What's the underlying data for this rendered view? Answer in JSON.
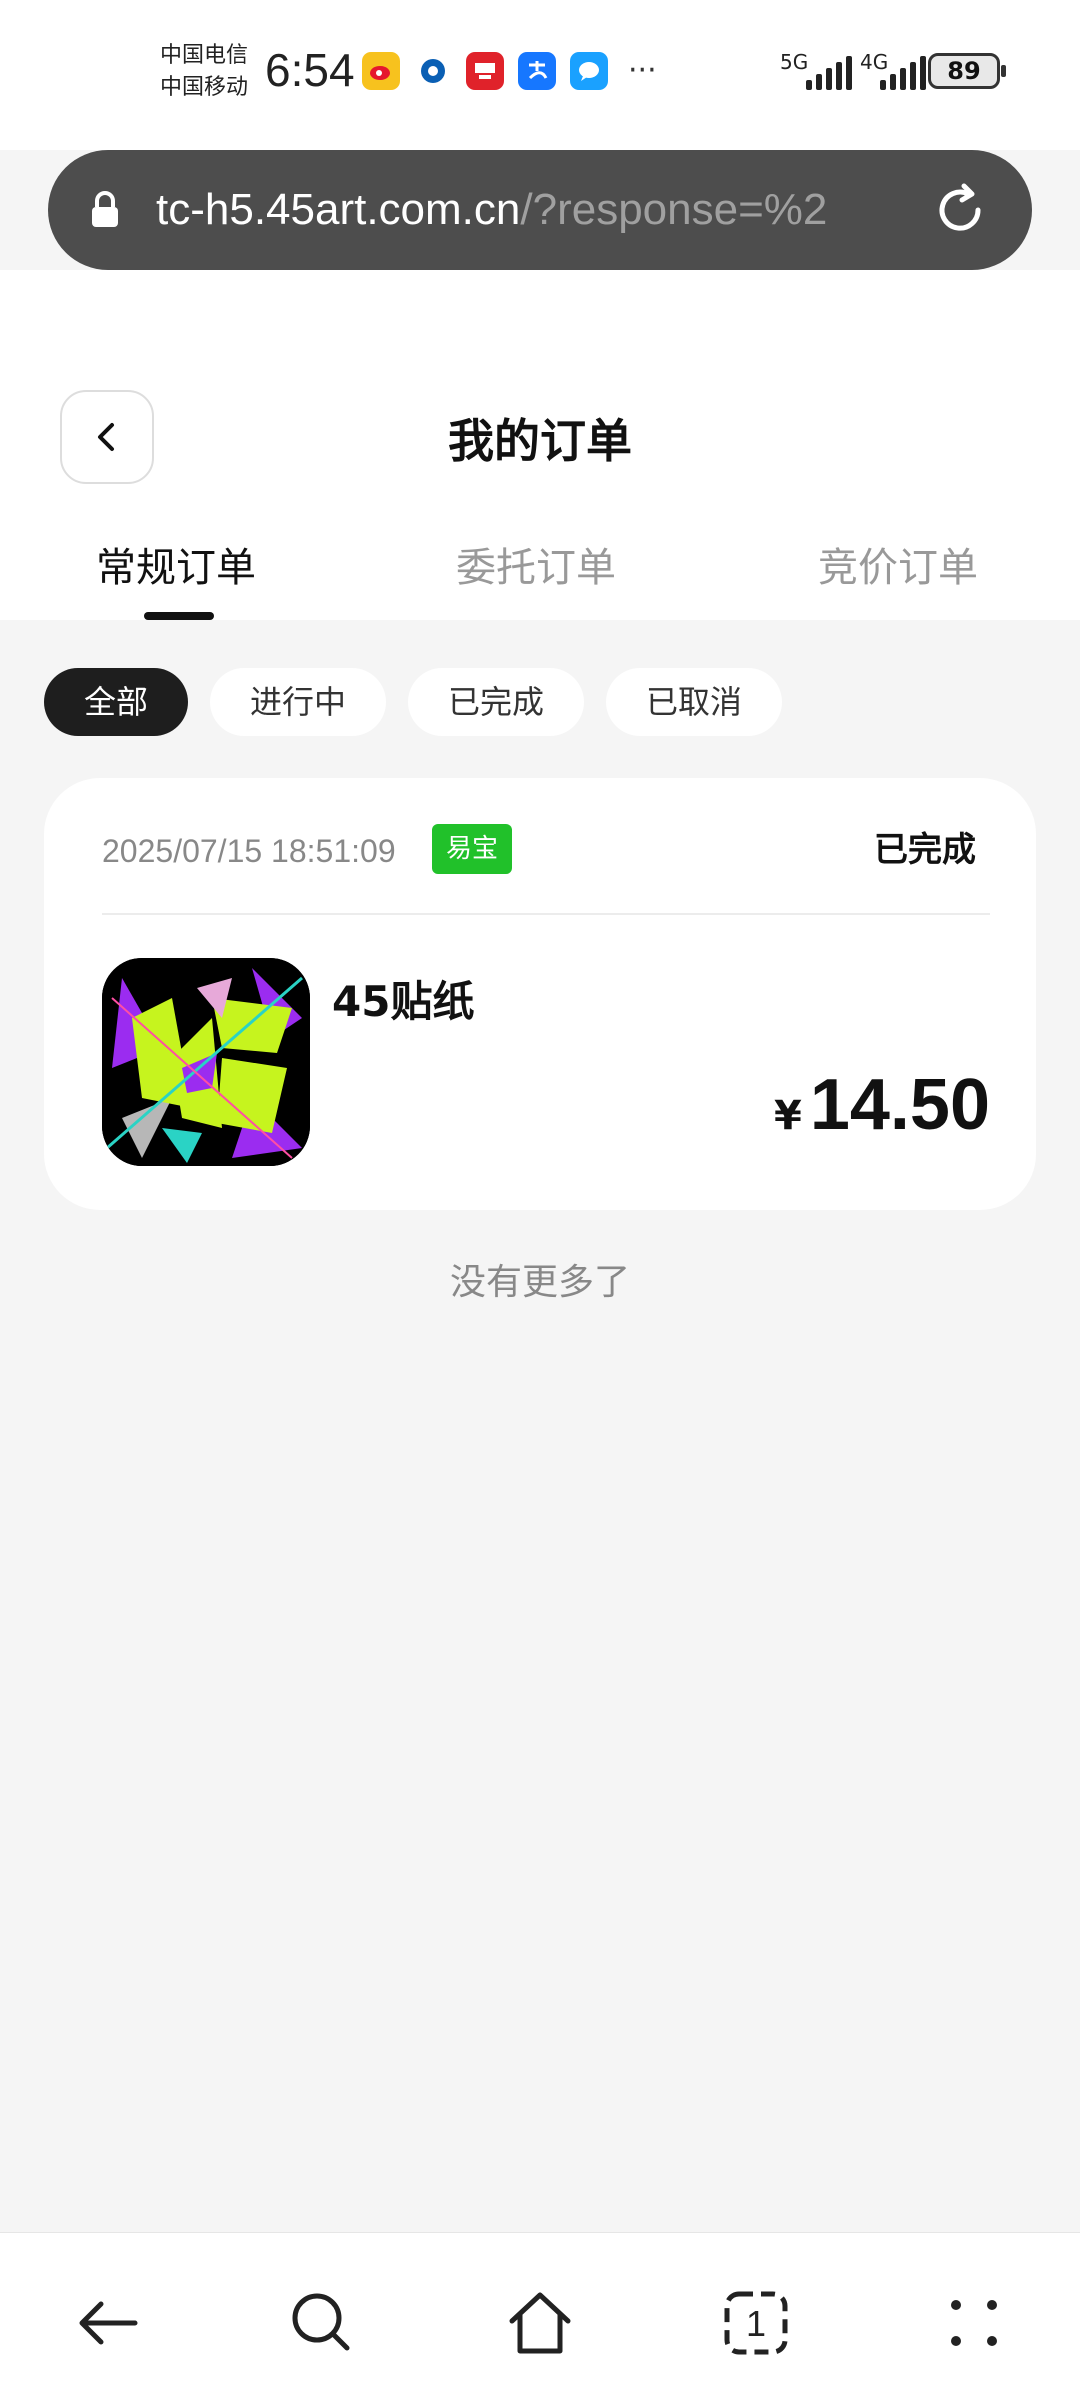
{
  "status_bar": {
    "carrier_1": "中国电信",
    "carrier_2": "中国移动",
    "time": "6:54",
    "net_1": "5G",
    "net_2": "4G",
    "battery": "89",
    "app_icons": [
      "weibo-icon",
      "bank-icon",
      "news-app-icon",
      "alipay-icon",
      "messages-icon"
    ]
  },
  "browser": {
    "url_main": "tc-h5.45art.com.cn",
    "url_rest": "/?response=%2"
  },
  "header": {
    "title": "我的订单"
  },
  "tabs": [
    {
      "label": "常规订单",
      "active": true
    },
    {
      "label": "委托订单",
      "active": false
    },
    {
      "label": "竞价订单",
      "active": false
    }
  ],
  "filters": [
    {
      "label": "全部",
      "active": true
    },
    {
      "label": "进行中",
      "active": false
    },
    {
      "label": "已完成",
      "active": false
    },
    {
      "label": "已取消",
      "active": false
    }
  ],
  "order": {
    "datetime": "2025/07/15 18:51:09",
    "badge": "易宝",
    "status": "已完成",
    "product_name": "45贴纸",
    "currency": "¥",
    "price": "14.50"
  },
  "footer_text": "没有更多了",
  "colors": {
    "badge_green": "#21c12a",
    "url_bar_bg": "#4d4d4d",
    "active_chip_bg": "#1e1e1e",
    "page_bg": "#f5f5f5"
  }
}
